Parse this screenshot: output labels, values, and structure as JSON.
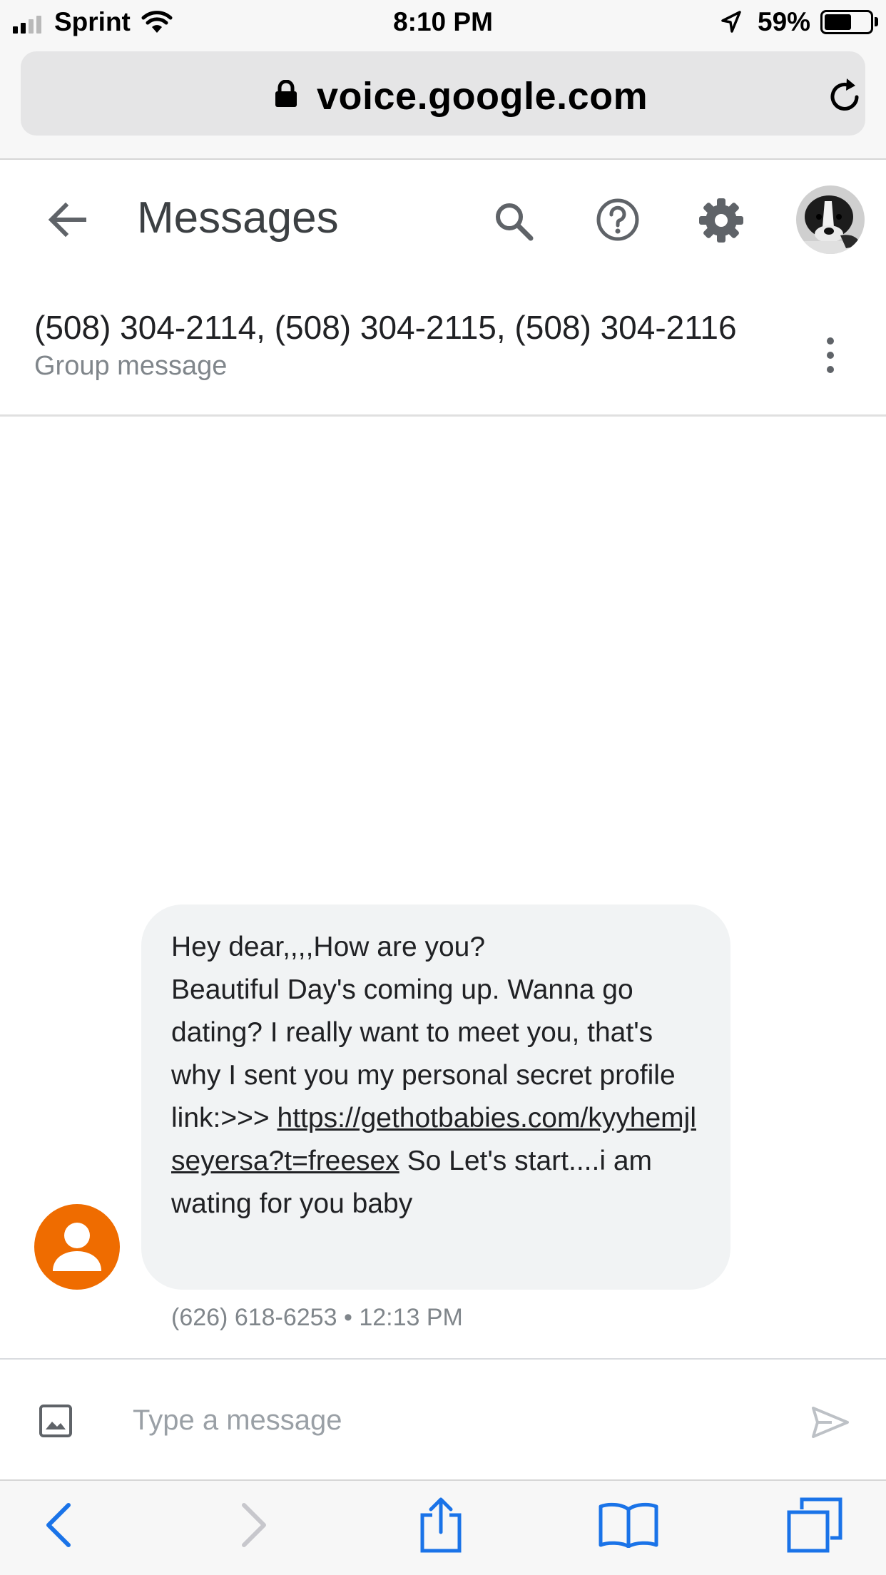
{
  "status_bar": {
    "carrier": "Sprint",
    "time": "8:10 PM",
    "battery_percent": "59%",
    "battery_level": 0.59,
    "icons": [
      "signal-icon",
      "wifi-icon",
      "location-icon",
      "battery-icon"
    ]
  },
  "browser": {
    "url": "voice.google.com",
    "icons": [
      "lock-icon",
      "reload-icon"
    ]
  },
  "app_bar": {
    "title": "Messages",
    "icons": [
      "back-arrow-icon",
      "search-icon",
      "help-icon",
      "settings-icon",
      "account-avatar"
    ]
  },
  "conversation": {
    "title": "(508) 304-2114, (508) 304-2115, (508) 304-2116",
    "subtitle": "Group message"
  },
  "message": {
    "line1": "Hey dear,,,,How are you?",
    "body_before_link": "Beautiful Day's coming up. Wanna go dating? I really want to meet you, that's why I sent you my personal secret profile link:>>>",
    "link": "https://gethotbabies.com/kyyhemjlseyersa?t=freesex",
    "body_after_link": "So Let's start....i am wating for you baby",
    "sender": "(626) 618-6253",
    "separator": "•",
    "timestamp": "12:13 PM"
  },
  "composer": {
    "placeholder": "Type a message",
    "value": ""
  },
  "colors": {
    "sender_avatar": "#ef6c00",
    "bubble": "#f1f3f4",
    "ios_blue": "#1a73e8",
    "icon_gray": "#5f6368"
  },
  "toolbar": {
    "icons": [
      "back-nav-icon",
      "forward-nav-icon",
      "share-icon",
      "bookmarks-icon",
      "tabs-icon"
    ]
  }
}
